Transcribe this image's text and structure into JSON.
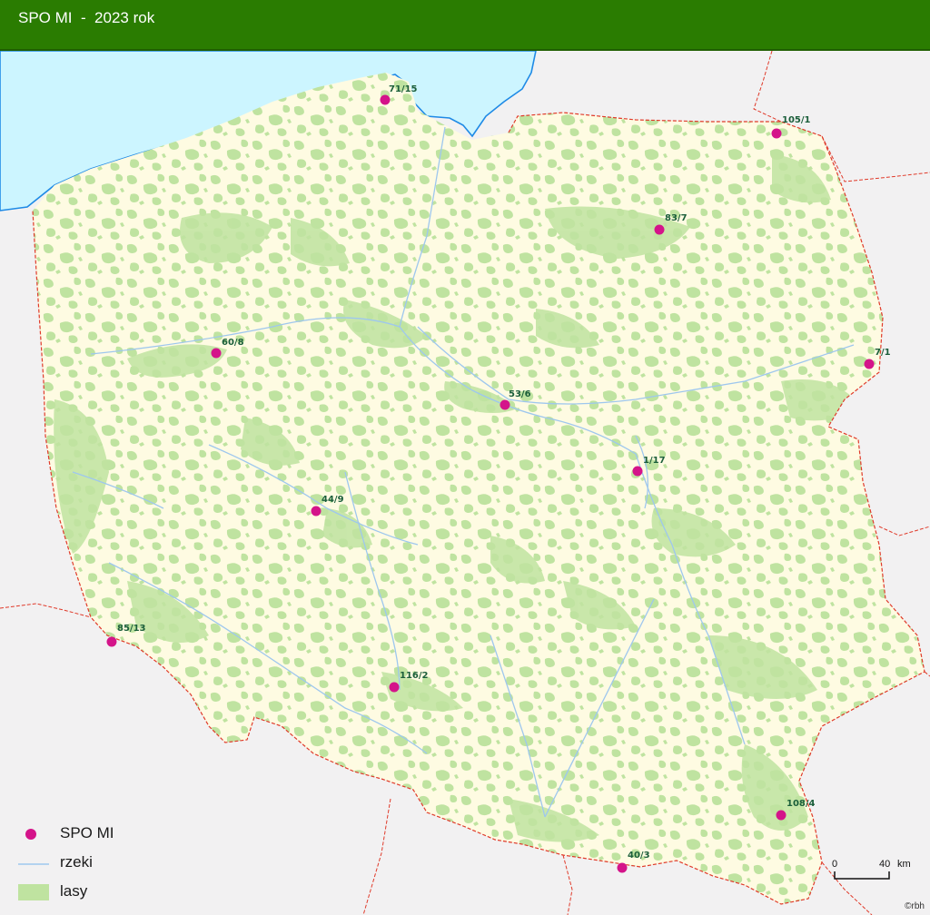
{
  "header": {
    "title": "SPO MI  -  2023 rok"
  },
  "colors": {
    "header": "#2a7c01",
    "sea": "#ccf5ff",
    "land": "#fefbe2",
    "forest": "#bfe3a0",
    "river": "#9ec7ee",
    "border": "#e03a2a",
    "site": "#d4148a",
    "site_label": "#1b5e3a"
  },
  "sites": [
    {
      "label": "71/15"
    },
    {
      "label": "105/1"
    },
    {
      "label": "83/7"
    },
    {
      "label": "60/8"
    },
    {
      "label": "7/1"
    },
    {
      "label": "53/6"
    },
    {
      "label": "1/17"
    },
    {
      "label": "44/9"
    },
    {
      "label": "85/13"
    },
    {
      "label": "116/2"
    },
    {
      "label": "108/4"
    },
    {
      "label": "40/3"
    }
  ],
  "legend": {
    "site": "SPO MI",
    "rivers": "rzeki",
    "forests": "lasy"
  },
  "scale": {
    "zero": "0",
    "end": "40",
    "unit": "km"
  },
  "credit": "©rbh"
}
